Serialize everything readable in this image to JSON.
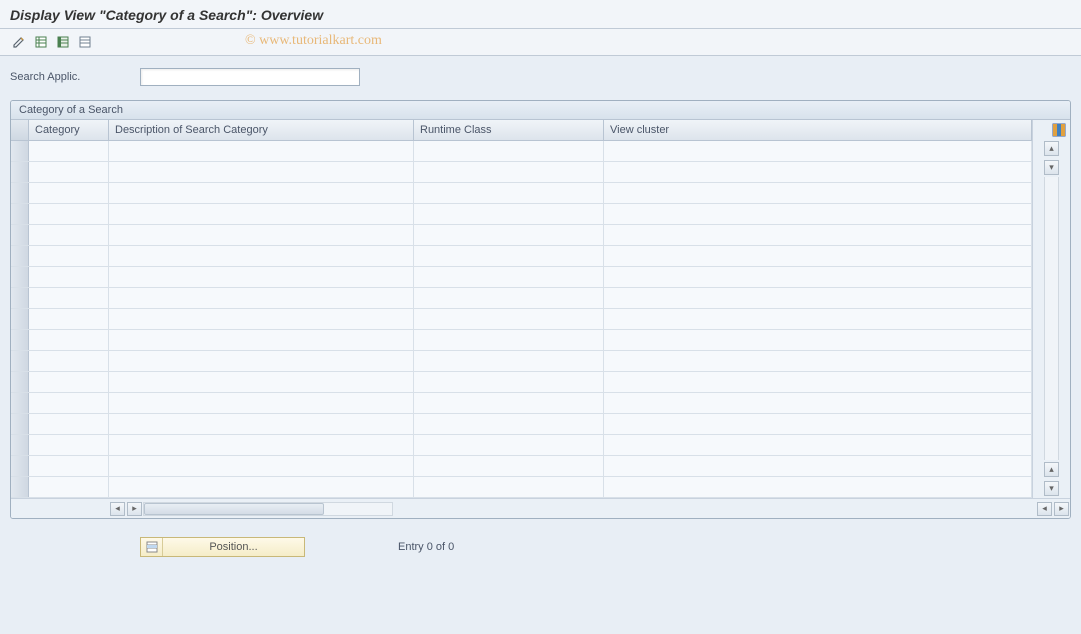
{
  "title": "Display View \"Category of a Search\": Overview",
  "watermark": "© www.tutorialkart.com",
  "toolbar": {
    "icons": [
      "pencil-icon",
      "table-select-icon",
      "table-deselect-icon",
      "table-block-icon"
    ]
  },
  "search_field": {
    "label": "Search Applic.",
    "value": ""
  },
  "panel": {
    "title": "Category of a Search",
    "columns": [
      {
        "key": "category",
        "label": "Category"
      },
      {
        "key": "desc",
        "label": "Description of Search Category"
      },
      {
        "key": "runtime",
        "label": "Runtime Class"
      },
      {
        "key": "view",
        "label": "View cluster"
      }
    ],
    "rows": [
      {},
      {},
      {},
      {},
      {},
      {},
      {},
      {},
      {},
      {},
      {},
      {},
      {},
      {},
      {},
      {},
      {}
    ]
  },
  "footer": {
    "position_label": "Position...",
    "entry_text": "Entry 0 of 0"
  }
}
